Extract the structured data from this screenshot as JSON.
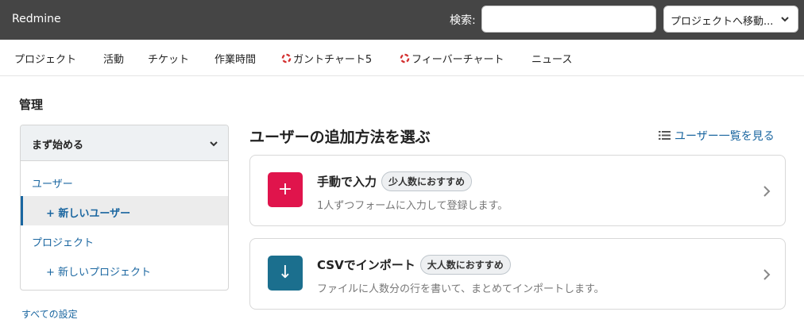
{
  "header": {
    "app_name": "Redmine",
    "search_label": "検索:",
    "search_value": "",
    "project_jump_label": "プロジェクトへ移動..."
  },
  "main_menu": {
    "items": [
      {
        "label": "プロジェクト"
      },
      {
        "label": "活動"
      },
      {
        "label": "チケット"
      },
      {
        "label": "作業時間"
      },
      {
        "label": "ガントチャート5",
        "icon": "plugin-gear-icon"
      },
      {
        "label": "フィーバーチャート",
        "icon": "plugin-gear-icon"
      },
      {
        "label": "ニュース"
      }
    ]
  },
  "page": {
    "title": "管理"
  },
  "sidebar": {
    "header": "まず始める",
    "items": [
      {
        "label": "ユーザー"
      },
      {
        "label": "+ 新しいユーザー"
      },
      {
        "label": "プロジェクト"
      },
      {
        "label": "+ 新しいプロジェクト"
      }
    ],
    "all_settings": "すべての設定"
  },
  "content": {
    "title": "ユーザーの追加方法を選ぶ",
    "user_list_link": "ユーザー一覧を見る",
    "options": [
      {
        "icon": "+",
        "title": "手動で入力",
        "badge": "少人数におすすめ",
        "description": "1人ずつフォームに入力して登録します。",
        "color": "#e0144c"
      },
      {
        "icon": "↓",
        "title": "CSVでインポート",
        "badge": "大人数におすすめ",
        "description": "ファイルに人数分の行を書いて、まとめてインポートします。",
        "color": "#1b6f8e"
      }
    ]
  },
  "colors": {
    "topbar": "#454545",
    "link": "#1a66a0",
    "plugin_icon": "#d32f2f"
  }
}
